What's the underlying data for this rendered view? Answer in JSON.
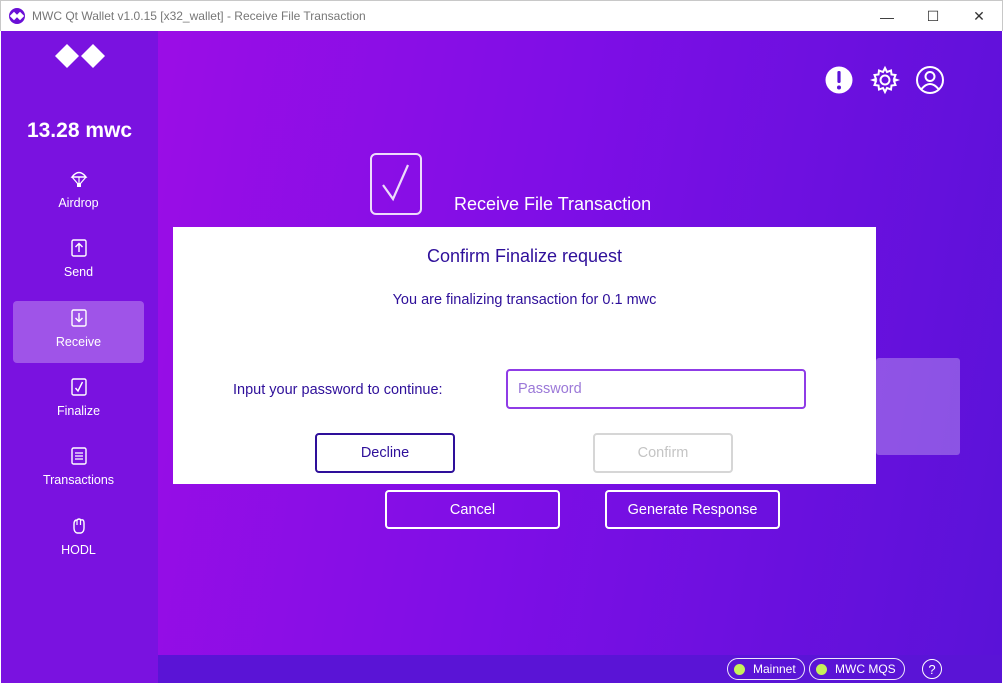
{
  "window": {
    "title": "MWC Qt Wallet v1.0.15 [x32_wallet] - Receive File Transaction",
    "controls": {
      "minimize": "—",
      "maximize": "☐",
      "close": "✕"
    }
  },
  "sidebar": {
    "balance": "13.28 mwc",
    "items": [
      {
        "label": "Airdrop",
        "icon": "parachute-icon",
        "active": false
      },
      {
        "label": "Send",
        "icon": "send-arrow-up-icon",
        "active": false
      },
      {
        "label": "Receive",
        "icon": "receive-arrow-down-icon",
        "active": true
      },
      {
        "label": "Finalize",
        "icon": "check-box-icon",
        "active": false
      },
      {
        "label": "Transactions",
        "icon": "list-document-icon",
        "active": false
      },
      {
        "label": "HODL",
        "icon": "fist-icon",
        "active": false
      }
    ]
  },
  "main": {
    "title": "Receive File Transaction",
    "buttons": {
      "cancel": "Cancel",
      "generate": "Generate Response"
    }
  },
  "dialog": {
    "title": "Confirm Finalize request",
    "message": "You are finalizing transaction for 0.1 mwc",
    "password_label": "Input your password to continue:",
    "password_placeholder": "Password",
    "decline": "Decline",
    "confirm": "Confirm"
  },
  "status": {
    "network": "Mainnet",
    "mqs": "MWC MQS",
    "help": "?"
  },
  "colors": {
    "sidebar": "#7a12e0",
    "accent": "#2e0f9a",
    "status_green": "#c6f15a"
  }
}
